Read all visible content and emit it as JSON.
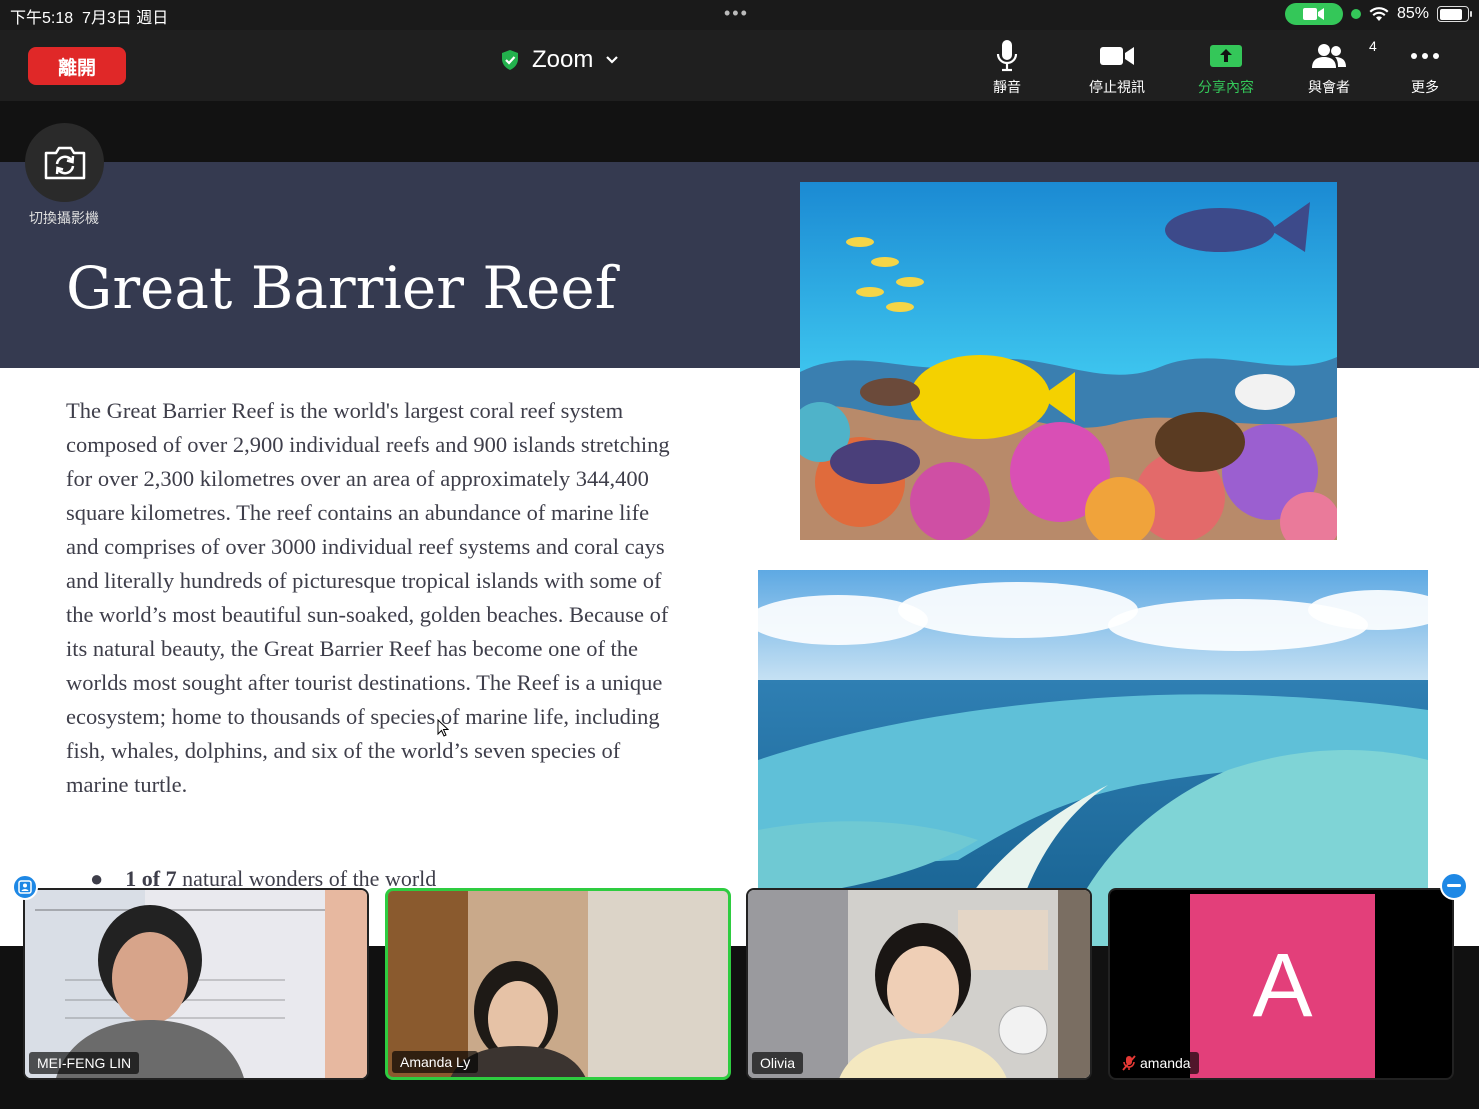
{
  "status_bar": {
    "time": "下午5:18",
    "date": "7月3日 週日",
    "battery": "85%",
    "battery_level": 0.85
  },
  "toolbar": {
    "leave_label": "離開",
    "meeting_title": "Zoom",
    "mute_label": "靜音",
    "stop_video_label": "停止視訊",
    "share_label": "分享內容",
    "participants_label": "與會者",
    "participants_count": "4",
    "more_label": "更多"
  },
  "switch_camera": {
    "label": "切換攝影機"
  },
  "slide": {
    "title": "Great Barrier Reef",
    "body": "The Great Barrier Reef is the world's largest coral reef system composed of over 2,900 individual reefs and 900 islands stretching for over 2,300 kilometres over an area of approximately 344,400 square kilometres. The reef contains an abundance of marine life and comprises of over 3000 individual reef systems and coral cays and literally hundreds of picturesque tropical islands with some of the world’s most beautiful sun-soaked, golden beaches. Because of its natural beauty, the Great Barrier Reef has become one of the worlds most sought after tourist destinations. The Reef is a unique ecosystem; home to thousands of species of marine life, including fish, whales, dolphins, and six of the world’s seven species of marine turtle.",
    "bullet_bold": "1 of 7",
    "bullet_rest": " natural wonders of the world"
  },
  "participants": [
    {
      "name": "MEI-FENG LIN",
      "active": false
    },
    {
      "name": "Amanda Ly",
      "active": true
    },
    {
      "name": "Olivia",
      "active": false
    },
    {
      "name": "amanda",
      "active": false,
      "avatar_letter": "A",
      "muted": true
    }
  ],
  "colors": {
    "leave": "#e02828",
    "share_green": "#34c759",
    "slide_header": "#353a50",
    "avatar_pink": "#e33f7a",
    "active_border": "#2ecc40"
  }
}
